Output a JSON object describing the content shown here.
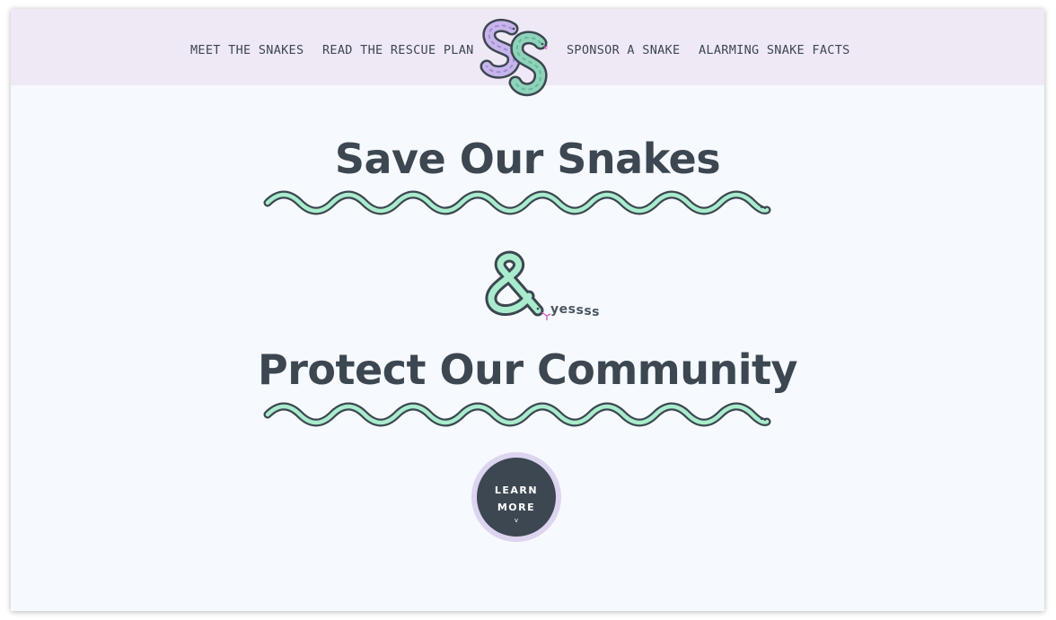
{
  "nav": {
    "meet": "MEET THE SNAKES",
    "rescue": "READ THE RESCUE PLAN",
    "sponsor": "SPONSOR A SNAKE",
    "facts": "ALARMING SNAKE FACTS"
  },
  "logo": {
    "text": "SS",
    "icon": "snake-logo-icon"
  },
  "hero": {
    "title1": "Save Our Snakes",
    "title2": "Protect Our Community",
    "ampersand_icon": "snake-ampersand-icon",
    "yes": [
      "yes",
      "s",
      "s",
      "s"
    ],
    "divider_icon": "wavy-snake-divider-icon"
  },
  "cta": {
    "line1": "LEARN",
    "line2": "MORE",
    "chevron": "v"
  },
  "colors": {
    "topbar": "#efe9f5",
    "page_bg": "#f6f9fe",
    "text": "#3c4751",
    "mint": "#a9eccd",
    "lavender": "#c7b5ec",
    "tongue": "#d15ac8",
    "ring": "#ddd4f0"
  }
}
